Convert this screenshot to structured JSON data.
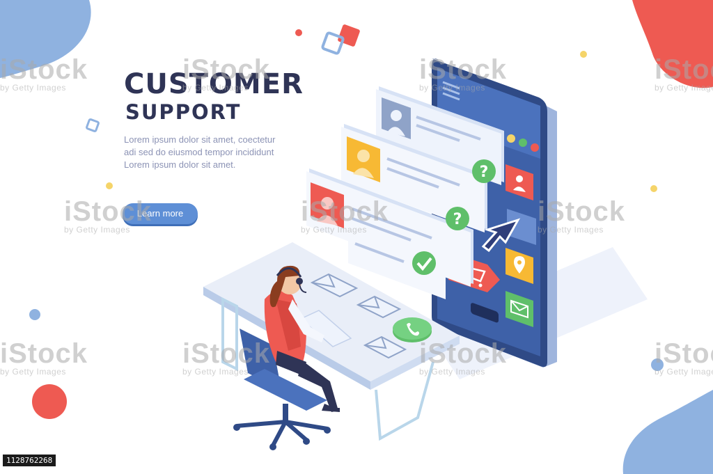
{
  "hero": {
    "title_line1": "CUSTOMER",
    "title_line2": "SUPPORT",
    "description": [
      "Lorem ipsum dolor sit amet, coectetur",
      "adi sed do eiusmod tempor incididunt",
      "Lorem ipsum dolor sit amet."
    ],
    "cta_label": "Learn more"
  },
  "watermark": {
    "brand": "iStock",
    "credit": "by Getty Images"
  },
  "image_id": "1128762268",
  "colors": {
    "title": "#2f3456",
    "text": "#8c93b5",
    "button": "#5e8fd6",
    "red_accent": "#ee5a52",
    "blue_accent": "#8fb2e0",
    "phone_body": "#3e61a8",
    "question_green": "#5fbf6a"
  },
  "icons": [
    "user-icon",
    "location-pin-icon",
    "mail-icon",
    "cart-icon",
    "cursor-arrow-icon",
    "question-icon",
    "check-icon",
    "phone-call-icon",
    "envelope-icon",
    "headset-icon"
  ]
}
